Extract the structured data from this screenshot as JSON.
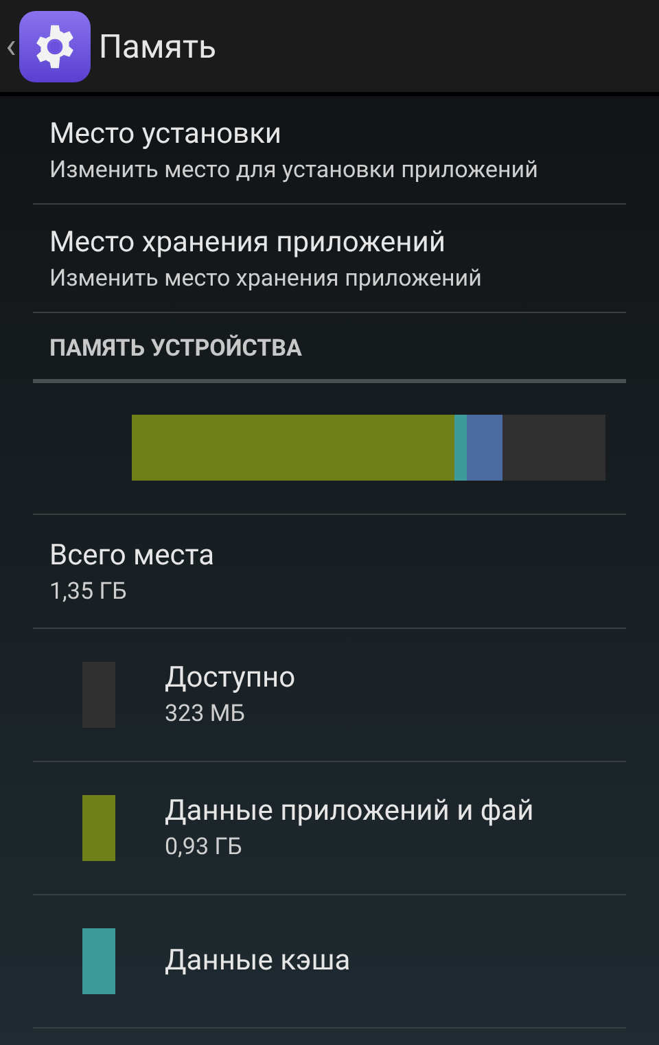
{
  "header": {
    "back": "‹",
    "title": "Память"
  },
  "settings": [
    {
      "title": "Место установки",
      "summary": "Изменить место для установки приложений"
    },
    {
      "title": "Место хранения приложений",
      "summary": "Изменить место хранения приложений"
    }
  ],
  "section": {
    "title": "ПАМЯТЬ УСТРОЙСТВА"
  },
  "usage_bar": [
    {
      "color": "#6f7f19"
    },
    {
      "color": "#3f9a9a"
    },
    {
      "color": "#4a6aa0"
    },
    {
      "color": "#303030"
    }
  ],
  "total": {
    "title": "Всего места",
    "value": "1,35 ГБ"
  },
  "legend": [
    {
      "color": "#303030",
      "label": "Доступно",
      "value": "323 МБ"
    },
    {
      "color": "#6f7f19",
      "label": "Данные приложений и фай",
      "value": "0,93 ГБ"
    },
    {
      "color": "#3f9a9a",
      "label": "Данные кэша"
    }
  ]
}
